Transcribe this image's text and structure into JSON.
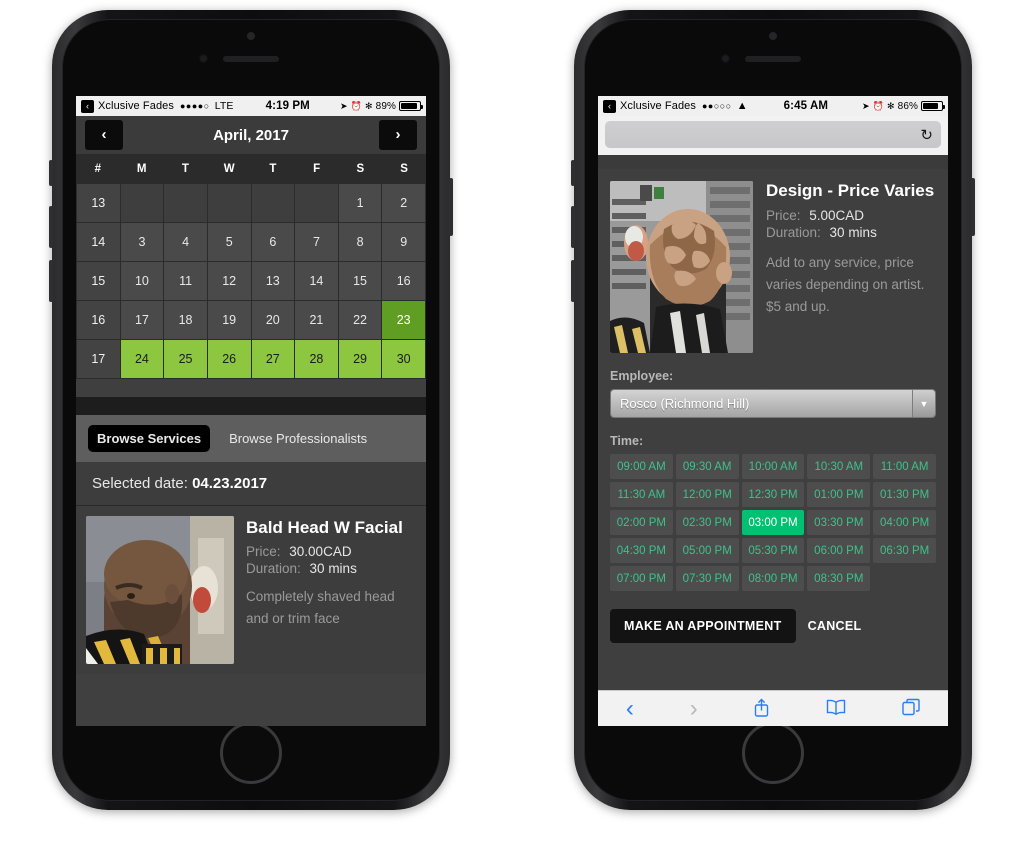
{
  "left_phone": {
    "status_bar": {
      "back_glyph": "‹",
      "carrier": "Xclusive Fades",
      "signal_dots": "●●●●○",
      "network": "LTE",
      "time": "4:19 PM",
      "location_icon": "➤",
      "alarm_icon": "⏰",
      "bluetooth_icon": "✻",
      "battery_percent": "89%",
      "battery_level": 89
    },
    "calendar": {
      "prev_label": "‹",
      "next_label": "›",
      "title": "April, 2017",
      "day_headers": [
        "#",
        "M",
        "T",
        "W",
        "T",
        "F",
        "S",
        "S"
      ],
      "weeks": [
        {
          "week": "13",
          "days": [
            "",
            "",
            "",
            "",
            "",
            "1",
            "2"
          ],
          "states": [
            "empty",
            "empty",
            "empty",
            "empty",
            "empty",
            "past",
            "past"
          ]
        },
        {
          "week": "14",
          "days": [
            "3",
            "4",
            "5",
            "6",
            "7",
            "8",
            "9"
          ],
          "states": [
            "past",
            "past",
            "past",
            "past",
            "past",
            "past",
            "past"
          ]
        },
        {
          "week": "15",
          "days": [
            "10",
            "11",
            "12",
            "13",
            "14",
            "15",
            "16"
          ],
          "states": [
            "past",
            "past",
            "past",
            "past",
            "past",
            "past",
            "past"
          ]
        },
        {
          "week": "16",
          "days": [
            "17",
            "18",
            "19",
            "20",
            "21",
            "22",
            "23"
          ],
          "states": [
            "past",
            "past",
            "past",
            "past",
            "past",
            "past",
            "selected"
          ]
        },
        {
          "week": "17",
          "days": [
            "24",
            "25",
            "26",
            "27",
            "28",
            "29",
            "30"
          ],
          "states": [
            "available",
            "available",
            "available",
            "available",
            "available",
            "available",
            "available"
          ]
        }
      ]
    },
    "tabs": [
      {
        "label": "Browse Services",
        "active": true
      },
      {
        "label": "Browse Professionalists",
        "active": false
      }
    ],
    "selected_date_label": "Selected date:",
    "selected_date_value": "04.23.2017",
    "service": {
      "title": "Bald Head W Facial",
      "price_label": "Price:",
      "price_value": "30.00CAD",
      "duration_label": "Duration:",
      "duration_value": "30 mins",
      "description": "Completely shaved head and or trim face",
      "photo_alt": "bald-head-client-photo"
    }
  },
  "right_phone": {
    "status_bar": {
      "back_glyph": "‹",
      "carrier": "Xclusive Fades",
      "signal_dots": "●●○○○",
      "wifi_icon": "▲",
      "time": "6:45 AM",
      "location_icon": "➤",
      "alarm_icon": "⏰",
      "bluetooth_icon": "✻",
      "battery_percent": "86%",
      "battery_level": 86
    },
    "safari": {
      "url_text": "",
      "reload_icon": "↻",
      "toolbar": {
        "back_icon": "‹",
        "forward_icon": "›",
        "share_icon": "↑",
        "bookmarks_icon": "▥",
        "tabs_icon": "❐"
      }
    },
    "service": {
      "title": "Design - Price Varies",
      "price_label": "Price:",
      "price_value": "5.00CAD",
      "duration_label": "Duration:",
      "duration_value": "30 mins",
      "description": "Add to any service, price varies depending on artist.",
      "description_extra": "$5 and up.",
      "photo_alt": "hair-design-client-photo"
    },
    "employee": {
      "label": "Employee:",
      "selected": "Rosco (Richmond Hill)",
      "arrow_glyph": "▼"
    },
    "time_section": {
      "label": "Time:",
      "selected": "03:00 PM",
      "slots": [
        "09:00 AM",
        "09:30 AM",
        "10:00 AM",
        "10:30 AM",
        "11:00 AM",
        "11:30 AM",
        "12:00 PM",
        "12:30 PM",
        "01:00 PM",
        "01:30 PM",
        "02:00 PM",
        "02:30 PM",
        "03:00 PM",
        "03:30 PM",
        "04:00 PM",
        "04:30 PM",
        "05:00 PM",
        "05:30 PM",
        "06:00 PM",
        "06:30 PM",
        "07:00 PM",
        "07:30 PM",
        "08:00 PM",
        "08:30 PM"
      ]
    },
    "actions": {
      "primary": "MAKE AN APPOINTMENT",
      "secondary": "CANCEL"
    }
  },
  "colors": {
    "available_green": "#8dc63f",
    "selected_green": "#5f9e22",
    "slot_green_text": "#3ec28a",
    "slot_selected": "#00c172",
    "safari_blue": "#2b7df6"
  }
}
